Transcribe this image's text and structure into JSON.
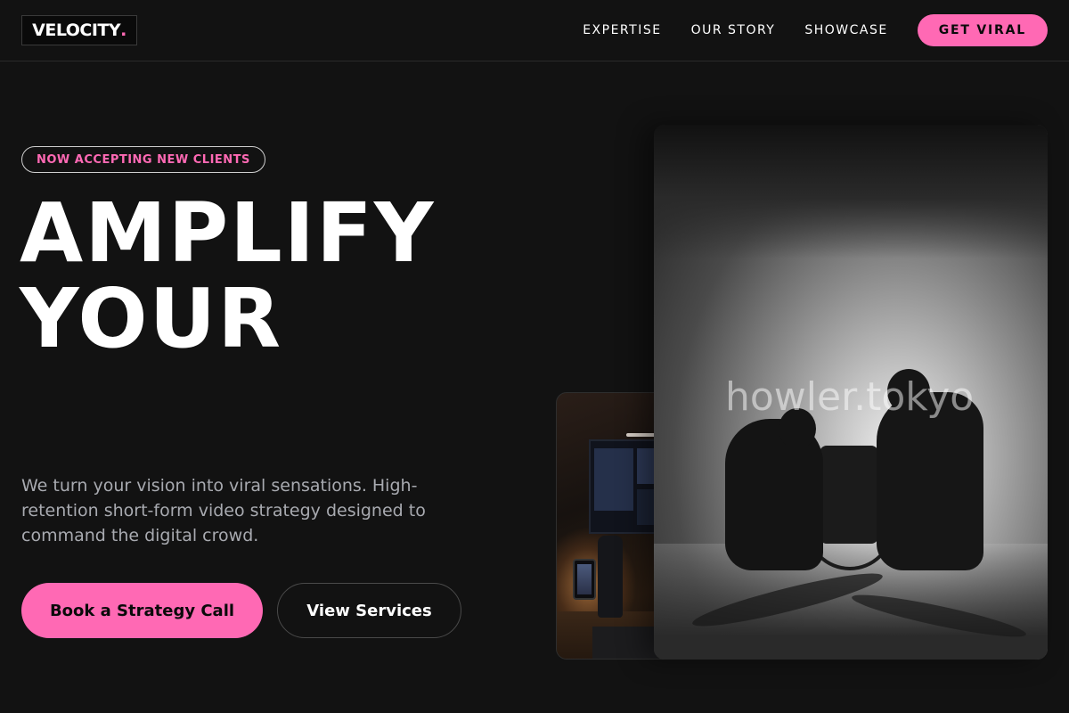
{
  "header": {
    "logo_text": "VELOCITY",
    "logo_dot": ".",
    "nav": [
      {
        "label": "EXPERTISE"
      },
      {
        "label": "OUR STORY"
      },
      {
        "label": "SHOWCASE"
      }
    ],
    "cta_label": "GET VIRAL"
  },
  "hero": {
    "badge": "NOW ACCEPTING NEW CLIENTS",
    "headline_line1": "AMPLIFY",
    "headline_line2": "YOUR",
    "description": "We turn your vision into viral sensations. High-retention short-form video strategy designed to command the digital crowd.",
    "primary_button": "Book a Strategy Call",
    "secondary_button": "View Services"
  },
  "media": {
    "crew_watermark": "howler.tokyo"
  },
  "colors": {
    "background": "#121212",
    "accent": "#ff69b4",
    "text": "#ffffff",
    "muted_text": "#a8aab0"
  }
}
